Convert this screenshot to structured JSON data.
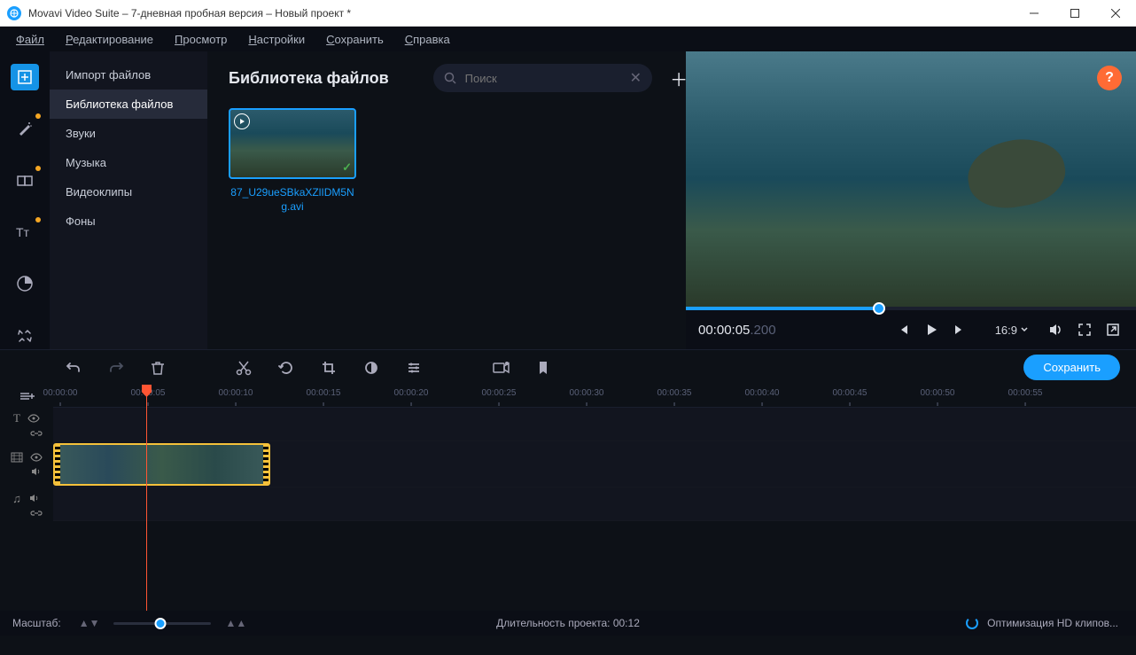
{
  "window": {
    "title": "Movavi Video Suite – 7-дневная пробная версия – Новый проект *"
  },
  "menu": {
    "file": "Файл",
    "edit": "Редактирование",
    "view": "Просмотр",
    "settings": "Настройки",
    "save": "Сохранить",
    "help": "Справка"
  },
  "sidebar": {
    "items": [
      {
        "label": "Импорт файлов"
      },
      {
        "label": "Библиотека файлов"
      },
      {
        "label": "Звуки"
      },
      {
        "label": "Музыка"
      },
      {
        "label": "Видеоклипы"
      },
      {
        "label": "Фоны"
      }
    ]
  },
  "content": {
    "title": "Библиотека файлов",
    "search_placeholder": "Поиск",
    "clip": {
      "name": "87_U29ueSBkaXZlIDM5Ng.avi"
    }
  },
  "preview": {
    "time": "00:00:05",
    "time_ms": ".200",
    "aspect": "16:9",
    "help": "?"
  },
  "toolbar": {
    "save": "Сохранить"
  },
  "ruler": [
    "00:00:00",
    "00:00:05",
    "00:00:10",
    "00:00:15",
    "00:00:20",
    "00:00:25",
    "00:00:30",
    "00:00:35",
    "00:00:40",
    "00:00:45",
    "00:00:50",
    "00:00:55"
  ],
  "status": {
    "zoom_label": "Масштаб:",
    "duration": "Длительность проекта:  00:12",
    "optimizing": "Оптимизация HD клипов..."
  }
}
